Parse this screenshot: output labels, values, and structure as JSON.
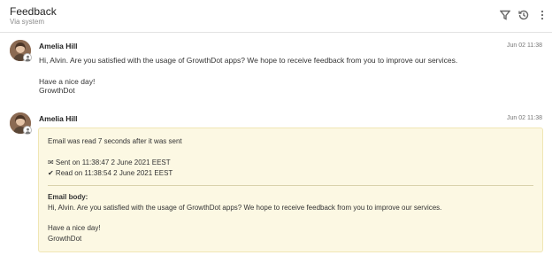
{
  "header": {
    "title": "Feedback",
    "subtitle": "Via system",
    "tools": [
      {
        "name": "filter-icon"
      },
      {
        "name": "history-icon"
      },
      {
        "name": "more-vertical-icon"
      }
    ]
  },
  "messages": [
    {
      "sender": "Amelia Hill",
      "date": "Jun 02 11:38",
      "lines": [
        "Hi, Alvin. Are you satisfied with the usage of GrowthDot apps? We hope to receive feedback from you to improve our services.",
        "Have a nice day!",
        "GrowthDot"
      ]
    },
    {
      "sender": "Amelia Hill",
      "date": "Jun 02 11:38",
      "card": {
        "read_notice": "Email was read 7 seconds after it was sent",
        "sent": "✉ Sent on 11:38:47 2 June 2021 EEST",
        "read": "✔ Read on 11:38:54 2 June 2021 EEST",
        "body_label": "Email body:",
        "body_lines": [
          "Hi, Alvin. Are you satisfied with the usage of GrowthDot apps? We hope to receive feedback from you to improve our services.",
          "Have a nice day!",
          "GrowthDot"
        ]
      }
    }
  ]
}
